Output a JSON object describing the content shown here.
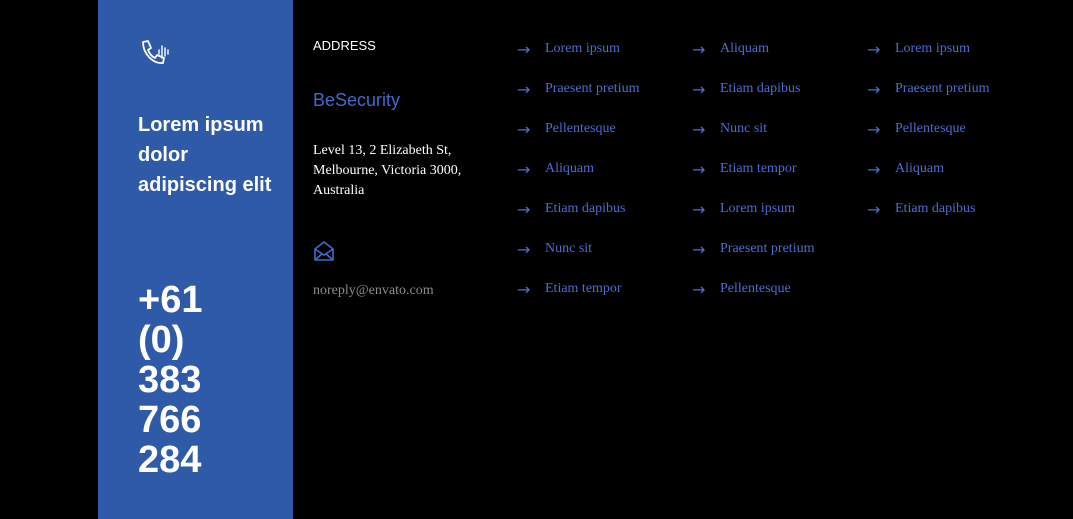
{
  "contact": {
    "tagline": "Lorem ipsum dolor adipiscing elit",
    "phone": "+61 (0) 383 766 284"
  },
  "address": {
    "heading": "ADDRESS",
    "brand": "BeSecurity",
    "text": "Level 13, 2 Elizabeth St, Melbourne, Victoria 3000, Australia",
    "email": "noreply@envato.com"
  },
  "icons": {
    "phone": "phone-icon",
    "mail": "envelope-open-icon",
    "arrow": "→"
  },
  "colors": {
    "panel": "#2f5aa8",
    "link": "#4a6ed1",
    "brand": "#3f6bc9"
  },
  "links": {
    "col1": [
      "Lorem ipsum",
      "Praesent pretium",
      "Pellentesque",
      "Aliquam",
      "Etiam dapibus",
      "Nunc sit",
      "Etiam tempor"
    ],
    "col2": [
      "Aliquam",
      "Etiam dapibus",
      "Nunc sit",
      "Etiam tempor",
      "Lorem ipsum",
      "Praesent pretium",
      "Pellentesque"
    ],
    "col3": [
      "Lorem ipsum",
      "Praesent pretium",
      "Pellentesque",
      "Aliquam",
      "Etiam dapibus"
    ]
  }
}
